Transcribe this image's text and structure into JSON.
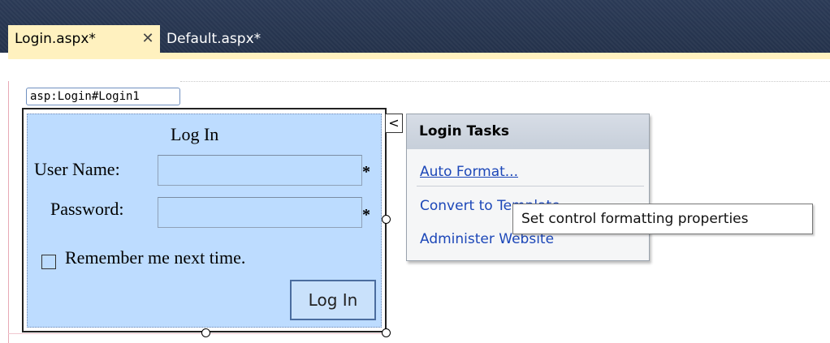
{
  "tabs": [
    {
      "label": "Login.aspx*",
      "active": true,
      "close_glyph": "✕"
    },
    {
      "label": "Default.aspx*",
      "active": false
    }
  ],
  "control_tag": "asp:Login#Login1",
  "login_control": {
    "title": "Log In",
    "username_label": "User Name:",
    "password_label": "Password:",
    "required_mark": "*",
    "remember_label": "Remember me next time.",
    "button_label": "Log In"
  },
  "smart_tag_glyph": "<",
  "tasks_panel": {
    "title": "Login Tasks",
    "items": [
      "Auto Format...",
      "Convert to Template",
      "Administer Website"
    ]
  },
  "tooltip": "Set control formatting properties",
  "colors": {
    "header_bg": "#2b3a56",
    "active_tab": "#fff1bf",
    "login_panel_bg": "#bddcff",
    "task_link": "#1c47b8"
  },
  "icons": [
    "close-icon",
    "smart-tag-chevron-icon",
    "checkbox-icon"
  ]
}
